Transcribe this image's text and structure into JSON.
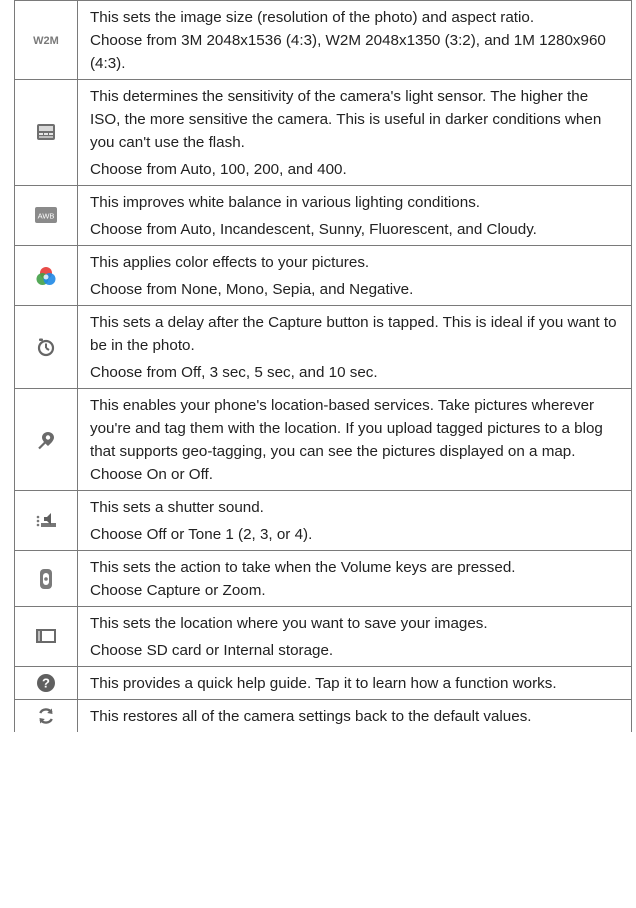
{
  "rows": [
    {
      "icon": "image-size-w2m-icon",
      "icon_text": "W2M",
      "paras": [
        {
          "text": "This sets the image size (resolution of the photo) and aspect ratio."
        },
        {
          "text": "Choose from 3M 2048x1536 (4:3), W2M 2048x1350 (3:2), and 1M 1280x960 (4:3)."
        }
      ]
    },
    {
      "icon": "iso-icon",
      "paras": [
        {
          "text": "This determines the sensitivity of the camera's light sensor. The higher the ISO, the more sensitive the camera. This is useful in darker conditions when you can't use the flash."
        },
        {
          "text": "Choose from Auto, 100, 200, and 400."
        }
      ]
    },
    {
      "icon": "white-balance-awb-icon",
      "icon_text": "AWB",
      "paras": [
        {
          "text": "This improves white balance in various lighting conditions."
        },
        {
          "text": "Choose from Auto, Incandescent, Sunny, Fluorescent, and Cloudy."
        }
      ]
    },
    {
      "icon": "color-effect-icon",
      "paras": [
        {
          "text": "This applies color effects to your pictures."
        },
        {
          "text": "Choose from None, Mono, Sepia, and Negative."
        }
      ]
    },
    {
      "icon": "timer-icon",
      "paras": [
        {
          "text": "This sets a delay after the Capture button is tapped. This is ideal if you want to be in the photo."
        },
        {
          "text": "Choose from Off, 3 sec, 5 sec, and 10 sec."
        }
      ]
    },
    {
      "icon": "geotagging-icon",
      "paras": [
        {
          "text": "This enables your phone's location-based services. Take pictures wherever you're and tag them with the location. If you upload tagged pictures to a blog that supports geo-tagging, you can see the pictures displayed on a map."
        },
        {
          "text": "Choose On or Off."
        }
      ]
    },
    {
      "icon": "shutter-sound-icon",
      "paras": [
        {
          "text": "This sets a shutter sound."
        },
        {
          "text": "Choose Off or Tone 1 (2, 3, or 4)."
        }
      ]
    },
    {
      "icon": "volume-key-icon",
      "paras": [
        {
          "text": "This sets the action to take when the Volume keys are pressed."
        },
        {
          "text": "Choose Capture or Zoom."
        }
      ]
    },
    {
      "icon": "storage-icon",
      "paras": [
        {
          "text": "This sets the location where you want to save your images."
        },
        {
          "text": "Choose SD card or Internal storage."
        }
      ]
    },
    {
      "icon": "help-icon",
      "paras": [
        {
          "text": "This provides a quick help guide. Tap it to learn how a function works."
        }
      ]
    },
    {
      "icon": "reset-icon",
      "paras": [
        {
          "text": "This restores all of the camera settings back to the default values."
        }
      ]
    }
  ]
}
